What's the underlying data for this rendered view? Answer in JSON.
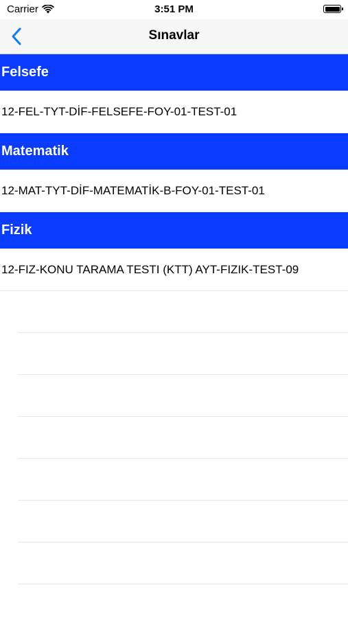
{
  "status": {
    "carrier": "Carrier",
    "time": "3:51 PM"
  },
  "nav": {
    "title": "Sınavlar"
  },
  "sections": [
    {
      "header": "Felsefe",
      "row": "12-FEL-TYT-DİF-FELSEFE-FOY-01-TEST-01"
    },
    {
      "header": "Matematik",
      "row": "12-MAT-TYT-DİF-MATEMATİK-B-FOY-01-TEST-01"
    },
    {
      "header": "Fizik",
      "row": "12-FIZ-KONU TARAMA TESTI (KTT) AYT-FIZIK-TEST-09"
    }
  ],
  "colors": {
    "section_bg": "#0a3cff",
    "accent": "#0a7aff"
  }
}
